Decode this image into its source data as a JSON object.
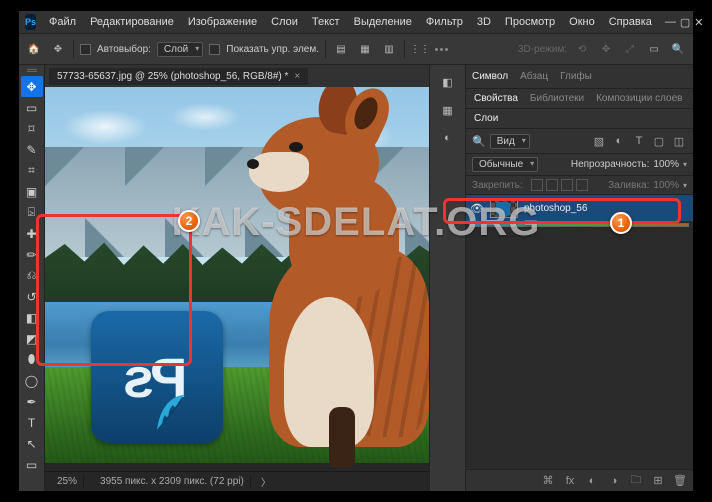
{
  "app": {
    "logo_text": "Ps"
  },
  "menu": {
    "file": "Файл",
    "edit": "Редактирование",
    "image": "Изображение",
    "layers": "Слои",
    "type": "Текст",
    "select": "Выделение",
    "filter": "Фильтр",
    "threeD": "3D",
    "view": "Просмотр",
    "window": "Окно",
    "help": "Справка"
  },
  "options": {
    "auto_select_label": "Автовыбор:",
    "auto_select_value": "Слой",
    "show_transform_label": "Показать упр. элем.",
    "mode_3d": "3D-режим:"
  },
  "document": {
    "tab_title": "57733-65637.jpg @ 25% (photoshop_56, RGB/8#) *",
    "zoom": "25%",
    "status": "3955 пикс. x 2309 пикс. (72 ppi)"
  },
  "placed": {
    "label": "Ps"
  },
  "right_tabs": {
    "char": "Символ",
    "para": "Абзац",
    "glyphs": "Глифы",
    "props": "Свойства",
    "libs": "Библиотеки",
    "comps": "Композиции слоев",
    "layers": "Слои"
  },
  "layers_panel": {
    "kind_label": "Вид",
    "blend_mode": "Обычные",
    "opacity_label": "Непрозрачность:",
    "opacity_value": "100%",
    "lock_label": "Закрепить:",
    "fill_label": "Заливка:",
    "fill_value": "100%",
    "layer_name": "photoshop_56"
  },
  "callouts": {
    "n1": "1",
    "n2": "2"
  },
  "watermark": "KAK-SDELAT.ORG"
}
